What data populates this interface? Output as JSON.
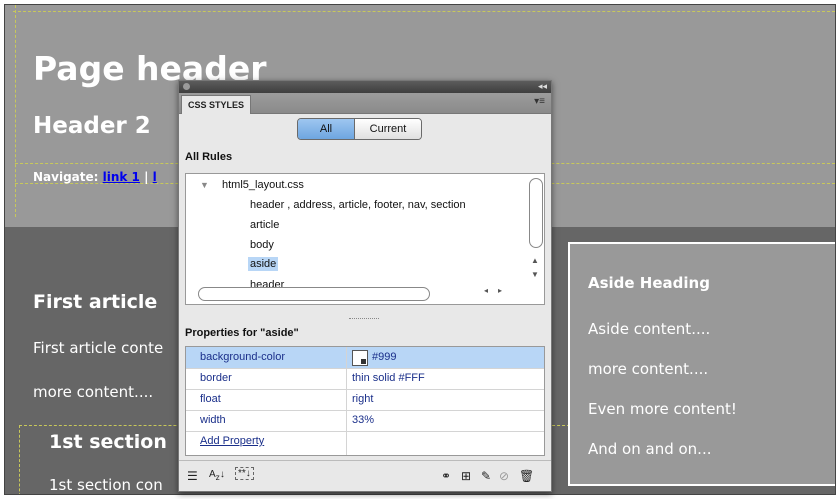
{
  "page": {
    "header_title": "Page header",
    "header_subtitle": "Header 2",
    "nav_label": "Navigate:",
    "nav_link_1": "link 1",
    "nav_sep": "|",
    "nav_link_2_partial": "l",
    "article_title": "First article",
    "article_text_1": "First article conte",
    "article_text_2": "more content....",
    "section_title": "1st section",
    "section_text": "1st section con",
    "aside_heading": "Aside Heading",
    "aside_lines": [
      "Aside content....",
      "more content....",
      "Even more content!",
      "And on and on..."
    ]
  },
  "panel": {
    "tab_label": "CSS STYLES",
    "segment_all": "All",
    "segment_current": "Current",
    "all_rules_label": "All Rules",
    "stylesheet": "html5_layout.css",
    "rules": [
      "header , address, article, footer, nav, section",
      "article",
      "body",
      "aside",
      "header"
    ],
    "selected_rule": "aside",
    "properties_label": "Properties for \"aside\"",
    "properties": [
      {
        "name": "background-color",
        "value": "#999"
      },
      {
        "name": "border",
        "value": "thin solid #FFF"
      },
      {
        "name": "float",
        "value": "right"
      },
      {
        "name": "width",
        "value": "33%"
      }
    ],
    "add_property": "Add Property",
    "icons": {
      "category_view": "≔",
      "alpha_view": "Aₓ↓",
      "set_only": "**↓"
    }
  },
  "colors": {
    "page_bg": "#666666",
    "header_bg": "#999999",
    "aside_bg": "#999999",
    "selection": "#b8d6f6"
  }
}
